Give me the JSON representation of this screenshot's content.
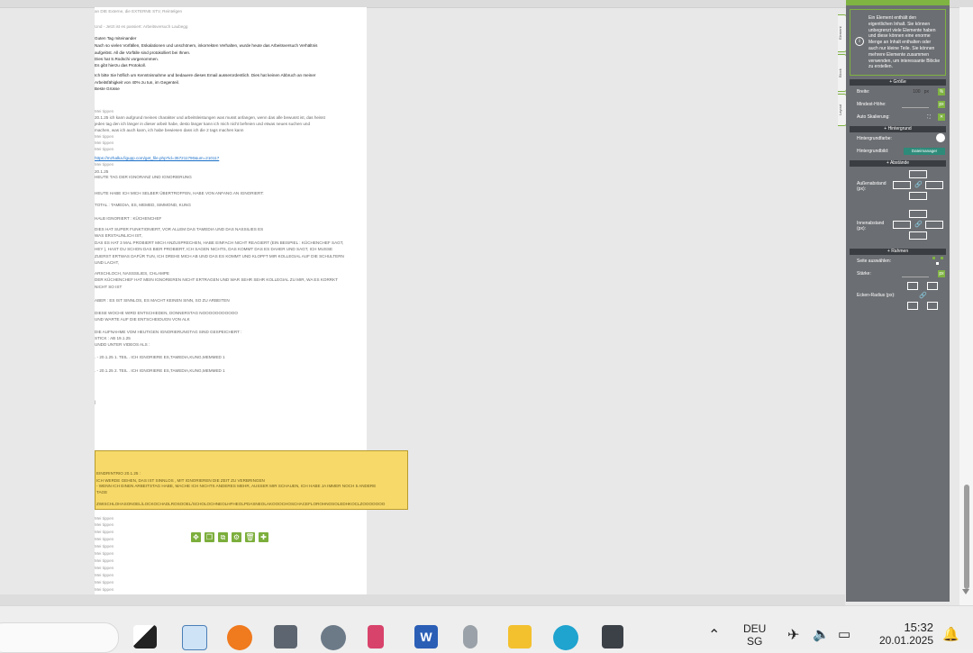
{
  "document": {
    "lines": [
      "an DIE Externe, die EXTERNE STV, Reintelgen",
      "Und - Jetzt ist es passiert: Arbeitsversuch Laubegg",
      "Guten Tag miteinander",
      "Nach so vielen Vorfällen, Eskalationen und unschönem, inkorrekten Verhalten, wurde heute das Arbeitsversuch Verhältnis",
      "aufgelöst. All die Vorfälle sind protokolliert bei Ihnen.",
      "Dies hat S.Rodschi vorgenommen.",
      "Es gibt hierzu das Protokoll.",
      "Ich bitte Sie höflich um Kenntnisnahme und bedauere dieses Email ausserordentlich. Dies hat keinen Abbruch an meiner",
      "Arbeitsfähigkeit von 40% zu tun, im Gegenteil.",
      "Beste Grüsse",
      "Mei tippen",
      "20.1.25 ich kann aufgrund meines charakter und arbeitsleistungen was musst anfangen, wenn das alle bewusst ist, das heisst",
      "jeden tag den ich länger in dieser arbeit habe, desto länger kann ich mich nicht befreien und etwas neues suchen und",
      "machen, was ich auch kann, ich habe bewiesen dass ich die 2 tags machen kann",
      "Mei tippen",
      "Mei tippen",
      "Mei tippen",
      "https://mzhalka.figupp.com/get_file.php?id=357211790&um=210117",
      "Mei tippen",
      "20.1.25",
      "HEUTE TAG DER IGNORANZ UND IGNORIERUNG",
      "HEUTE HABE ICH MICH SELBER ÜBERTROFFEN, HABE VON ANFANG AN  IGNORIERT:",
      "TOTAL : TAMEDIA, ES, MEMED, SIMMOND, KUNG",
      "HALB IGNORIERT : KÜCHENCHEF",
      "DIES HAT SUPER FUNKTIONIERT, VOR ALLEM DAS TAMEDIA UND DAS NASSILIES ES",
      "WAS ERSTAUNLICH IST,",
      "DAS ES HAT 3 MAL PROBIERT MICH ANZUSPRECHEN, HABE EINFACH NICHT REAGIERT (EIN BEISPIEL : KÜCHENCHEF SAGT,",
      "HEY ), HAST DU SCHON DAS BIER PROBIERT, ICH SAGEN NICHTS, DAS KOMMT DAS ES DAHER UND SAGT, ICH MUSSE",
      "ZUERST ERTWAS DAFÜR TUN, ICH DREHE MICH AB UND DAS ES KOMMT UND KLOPFT MIR KOLLEGIAL AUF DIE SCHULTERN",
      "UND LACHT,",
      "ARSCHLOCH, NASSSILIES, CHLAMPE",
      "DER KÜCHENCHEF HAT MEIN IGNORIEREN NICHT ERTRAGEN UND WAR SEHR SEHR KOLLEGIAL ZU MIR, WA ES KORRKT",
      "NICHT SO IST",
      "ABER : ES IST SINNLOS, ES MACHT KEINEN SINN, SO ZU ARBEITEN",
      "DIESE WOCHE WIRD ENTSCHIEDEN, DONNERSTAG NOOOOOOOOOOO",
      "UND WARTE AUF DIE ENTSCHEIDUGN VON ALK",
      "DIE AUFNAHME VOM HEUTIGEN IGNORIERUNGTAG SIND GESPEICHERT :",
      "STICK : AB 19.1.25",
      "UNDD UNTER VIDEOS ALS :",
      ". - 20.1.25 1. TEIL . ICH IGNORIERE ES,TAMEDIA,KUNG,MEMMED 1",
      ". - 20.1.25 2. TEIL . ICH IGNORIERE ES,TAMEDIA,KUNG,MEMMED 1",
      "|"
    ],
    "yellow_lines": [
      "EINDRINTRIO 20.1.25 :",
      "ICH WERDE GEHEN, DAS IST SINNLOS , MIT IGNORIEREN DIE ZEIT ZU VERBRINGEN",
      "- WENN ICH EINEN ARBEITSTAG HABE, MACHE ICH NICHTS ANDERES MEHR, AUSSER MIR SCHAUEN, ICH HABE JA IMMER NOCH 5 ANDERE",
      "TAGE",
      "ZWISCHLOHASONOEL/LOCKOCHADLROSOOEL/SCHOLOCHNEOLHFHEOLPDASNEOLAKOOOCHOSCHACEFLOROHNOSOLEDHKOCLZOOOOOOO"
    ],
    "footer_lines": [
      "Mei tippen",
      "Mei tippen",
      "Mei tippen",
      "Mei tippen",
      "Mei tippen",
      "Mei tippen",
      "Mei tippen",
      "Mei tippen",
      "Mei tippen",
      "Mei tippen",
      "Mei tippen"
    ]
  },
  "element_toolbar": [
    "move-icon",
    "copy-icon",
    "duplicate-icon",
    "settings-icon",
    "delete-icon",
    "add-icon"
  ],
  "panel": {
    "info_text": "Ein Element enthält den eigentlichen Inhalt. Sie können unbegrenzt viele Elemente haben und diese können eine enorme Menge an Inhalt enthalten oder auch nur kleine Teile. Sie können mehrere Elemente zusammen verwenden, um interessante Blöcke zu erstellen.",
    "tabs": [
      "Element",
      "Block",
      "Layout"
    ],
    "sections": {
      "groesse": "+ Größe",
      "hintergrund": "+ Hintergrund",
      "abstaende": "+ Abstände",
      "rahmen": "+ Rahmen"
    },
    "labels": {
      "breite": "Breite:",
      "breite_value": "100",
      "breite_unit": "px",
      "mindest_hoehe": "Mindest-Höhe:",
      "auto_skalierung": "Auto Skalierung:",
      "hintergrundfarbe": "Hintergrundfarbe:",
      "hintergrundbild": "Hintergrundbild:",
      "dateimanager": "Dateimanager",
      "aussenabstand": "Außenabstand (px):",
      "innenabstand": "Innenabstand (px):",
      "seite": "Seite auswählen:",
      "staerke": "Stärke:",
      "ecken_radius": "Ecken-Radius (px):"
    },
    "accent": "#7fb342"
  },
  "taskbar": {
    "language": "DEU",
    "region": "SG",
    "time": "15:32",
    "date": "20.01.2025",
    "apps": [
      "task-view-icon",
      "notepad-icon",
      "media-player-icon",
      "camera-icon",
      "settings-icon",
      "snipping-tool-icon",
      "word-icon",
      "microphone-icon",
      "file-explorer-icon",
      "edge-icon",
      "calculator-icon"
    ]
  }
}
